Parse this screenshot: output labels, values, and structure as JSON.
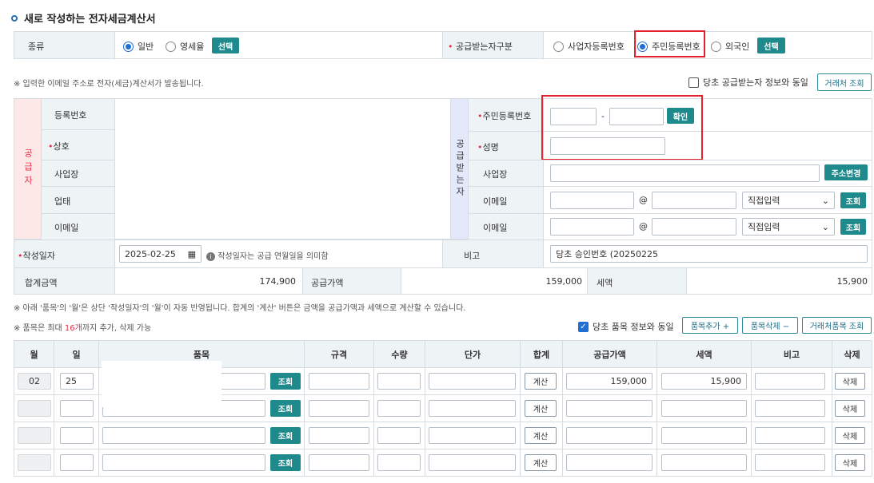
{
  "title": "새로 작성하는 전자세금계산서",
  "type_row": {
    "label": "종류",
    "options": [
      "일반",
      "영세율"
    ],
    "selected": "일반",
    "select_button": "선택",
    "recipient_label": "공급받는자구분",
    "recipient_options": [
      "사업자등록번호",
      "주민등록번호",
      "외국인"
    ],
    "recipient_selected": "주민등록번호",
    "recipient_select_button": "선택"
  },
  "notice_email": "※ 입력한 이메일 주소로 전자(세금)계산서가 발송됩니다.",
  "same_as_original_recipient": "당초 공급받는자 정보와 동일",
  "lookup_partner_button": "거래처 조회",
  "supplier": {
    "side_label": "공급자",
    "fields": [
      "등록번호",
      "상호",
      "사업장",
      "업태",
      "이메일"
    ]
  },
  "buyer": {
    "side_label": "공급받는자",
    "resident_no_label": "주민등록번호",
    "dash": "-",
    "confirm_button": "확인",
    "name_label": "성명",
    "address_label": "사업장",
    "address_change_button": "주소변경",
    "email_label": "이메일",
    "at": "@",
    "domain_select": "직접입력",
    "lookup_button": "조회"
  },
  "date_row": {
    "label": "작성일자",
    "value": "2025-02-25",
    "hint": "작성일자는 공급 연월일을 의미함",
    "remark_label": "비고",
    "remark_value": "당초 승인번호 (20250225"
  },
  "totals": {
    "total_label": "합계금액",
    "total_value": "174,900",
    "supply_label": "공급가액",
    "supply_value": "159,000",
    "tax_label": "세액",
    "tax_value": "15,900"
  },
  "notice_items": "※ 아래 '품목'의 '월'은 상단 '작성일자'의 '월'이 자동 반영됩니다. 합계의 '계산' 버튼은 금액을 공급가액과 세액으로 계산할 수 있습니다.",
  "notice_max_prefix": "※ 품목은 최대 ",
  "notice_max_count": "16개",
  "notice_max_suffix": "까지 추가, 삭제 가능",
  "same_as_original_items": "당초 품목 정보와 동일",
  "add_item_button": "품목추가 +",
  "delete_item_button": "품목삭제 −",
  "partner_item_lookup_button": "거래처품목 조회",
  "items_table": {
    "headers": [
      "월",
      "일",
      "품목",
      "규격",
      "수량",
      "단가",
      "합계",
      "공급가액",
      "세액",
      "비고",
      "삭제"
    ],
    "lookup_button": "조회",
    "calc_button": "계산",
    "delete_button": "삭제",
    "rows": [
      {
        "month": "02",
        "day": "25",
        "supply": "159,000",
        "tax": "15,900"
      },
      {
        "month": "",
        "day": "",
        "supply": "",
        "tax": ""
      },
      {
        "month": "",
        "day": "",
        "supply": "",
        "tax": ""
      },
      {
        "month": "",
        "day": "",
        "supply": "",
        "tax": ""
      }
    ]
  },
  "colors": {
    "accent_teal": "#1f8a8c",
    "highlight_red": "#e5202f",
    "supplier_pink": "#fde7e7",
    "buyer_blue": "#e3e8fb"
  }
}
